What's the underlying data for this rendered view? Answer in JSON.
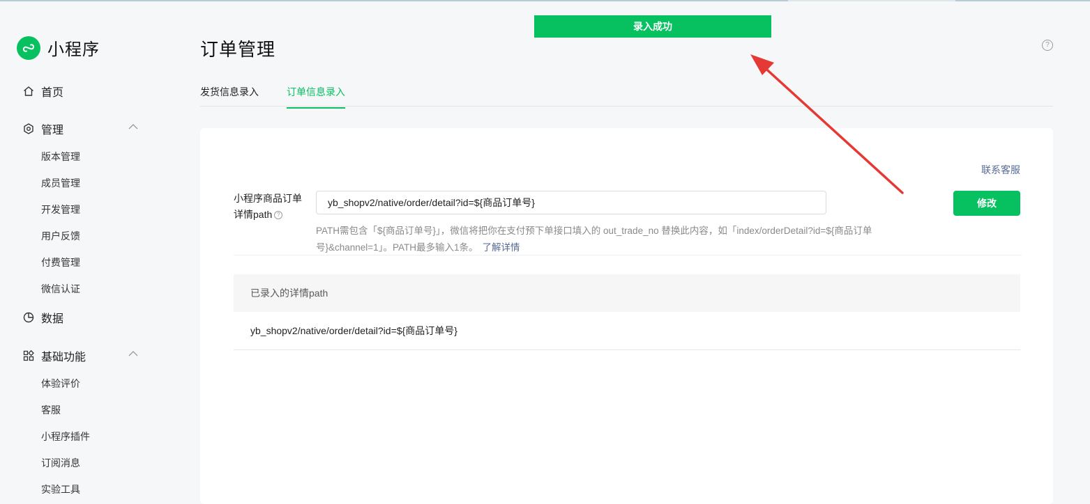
{
  "brand": {
    "name": "小程序"
  },
  "sidebar": {
    "home": "首页",
    "manage": {
      "label": "管理",
      "items": [
        "版本管理",
        "成员管理",
        "开发管理",
        "用户反馈",
        "付费管理",
        "微信认证"
      ]
    },
    "data": "数据",
    "basic": {
      "label": "基础功能",
      "items": [
        "体验评价",
        "客服",
        "小程序插件",
        "订阅消息",
        "实验工具"
      ]
    }
  },
  "page": {
    "title": "订单管理",
    "help": "?"
  },
  "tabs": [
    {
      "label": "发货信息录入",
      "active": false
    },
    {
      "label": "订单信息录入",
      "active": true
    }
  ],
  "toast": {
    "text": "录入成功"
  },
  "card": {
    "contact": "联系客服",
    "field": {
      "label_line1": "小程序商品订单",
      "label_line2": "详情path",
      "value": "yb_shopv2/native/order/detail?id=${商品订单号}",
      "desc": "PATH需包含「${商品订单号}」，微信将把你在支付预下单接口填入的 out_trade_no 替换此内容，如「index/orderDetail?id=${商品订单号}&channel=1」。PATH最多输入1条。",
      "learn_more": "了解详情"
    },
    "modify_button": "修改",
    "table": {
      "header": "已录入的详情path",
      "rows": [
        "yb_shopv2/native/order/detail?id=${商品订单号}"
      ]
    }
  },
  "colors": {
    "accent": "#07c160",
    "link": "#576b95",
    "arrow": "#e53935"
  },
  "icons": [
    "mini-program-logo",
    "home-icon",
    "hexagon-settings-icon",
    "chevron-up-icon",
    "pie-chart-icon",
    "grid-apps-icon",
    "question-circle-icon",
    "annotation-arrow"
  ]
}
